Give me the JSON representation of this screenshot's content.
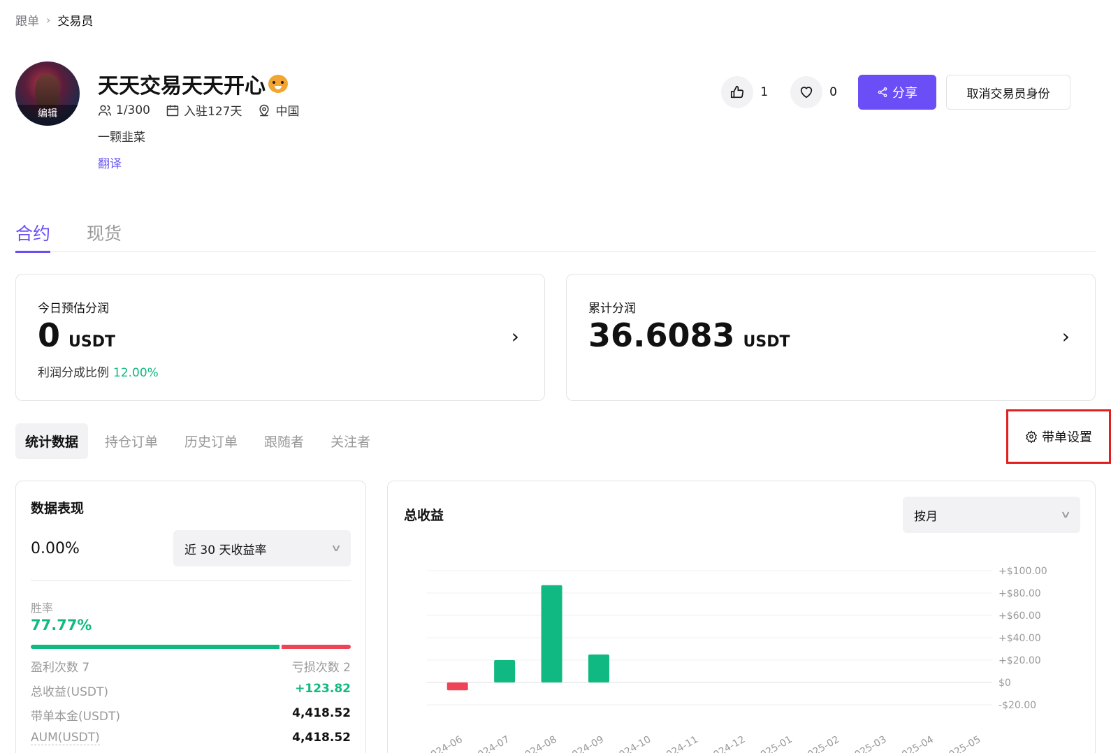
{
  "breadcrumb": {
    "root": "跟单",
    "current": "交易员"
  },
  "avatar": {
    "edit_label": "编辑"
  },
  "profile": {
    "name": "天天交易天天开心",
    "followers": "1/300",
    "joined": "入驻127天",
    "location": "中国",
    "bio": "一颗韭菜",
    "translate": "翻译"
  },
  "actions": {
    "likes": "1",
    "favorites": "0",
    "share_label": "分享",
    "cancel_label": "取消交易员身份"
  },
  "main_tabs": [
    {
      "label": "合约",
      "active": true
    },
    {
      "label": "现货",
      "active": false
    }
  ],
  "today_card": {
    "label": "今日预估分润",
    "value": "0",
    "unit": "USDT",
    "ratio_label": "利润分成比例",
    "ratio_value": "12.00%"
  },
  "total_card": {
    "label": "累计分润",
    "value": "36.6083",
    "unit": "USDT"
  },
  "sub_tabs": [
    {
      "label": "统计数据",
      "active": true
    },
    {
      "label": "持仓订单",
      "active": false
    },
    {
      "label": "历史订单",
      "active": false
    },
    {
      "label": "跟随者",
      "active": false
    },
    {
      "label": "关注者",
      "active": false
    }
  ],
  "settings": {
    "label": "带单设置"
  },
  "performance": {
    "title": "数据表现",
    "value": "0.00%",
    "select_label": "近 30 天收益率",
    "win_rate_label": "胜率",
    "win_rate_value": "77.77%",
    "win_rate_fraction": 0.7777,
    "profit_count": "盈利次数 7",
    "loss_count": "亏损次数 2",
    "rows": [
      {
        "key": "总收益(USDT)",
        "value": "+123.82"
      },
      {
        "key": "带单本金(USDT)",
        "value": "4,418.52"
      },
      {
        "key": "AUM(USDT)",
        "value": "4,418.52"
      }
    ]
  },
  "chart_card": {
    "title": "总收益",
    "period_label": "按月"
  },
  "colors": {
    "accent": "#6b4ef6",
    "positive": "#10b981",
    "negative": "#ef4456",
    "highlight_border": "#e21f1f"
  },
  "chart_data": {
    "type": "bar",
    "categories": [
      "2024-06",
      "2024-07",
      "2024-08",
      "2024-09",
      "2024-10",
      "2024-11",
      "2024-12",
      "2025-01",
      "2025-02",
      "2025-03",
      "2025-04",
      "2025-05"
    ],
    "values": [
      -7,
      20,
      87,
      25,
      0,
      0,
      0,
      0,
      0,
      0,
      0,
      0
    ],
    "ylim": [
      -20,
      100
    ],
    "yticks": [
      100,
      80,
      60,
      40,
      20,
      0,
      -20
    ],
    "ytick_labels": [
      "+$100.00",
      "+$80.00",
      "+$60.00",
      "+$40.00",
      "+$20.00",
      "$0",
      "-$20.00"
    ],
    "grid": true
  }
}
